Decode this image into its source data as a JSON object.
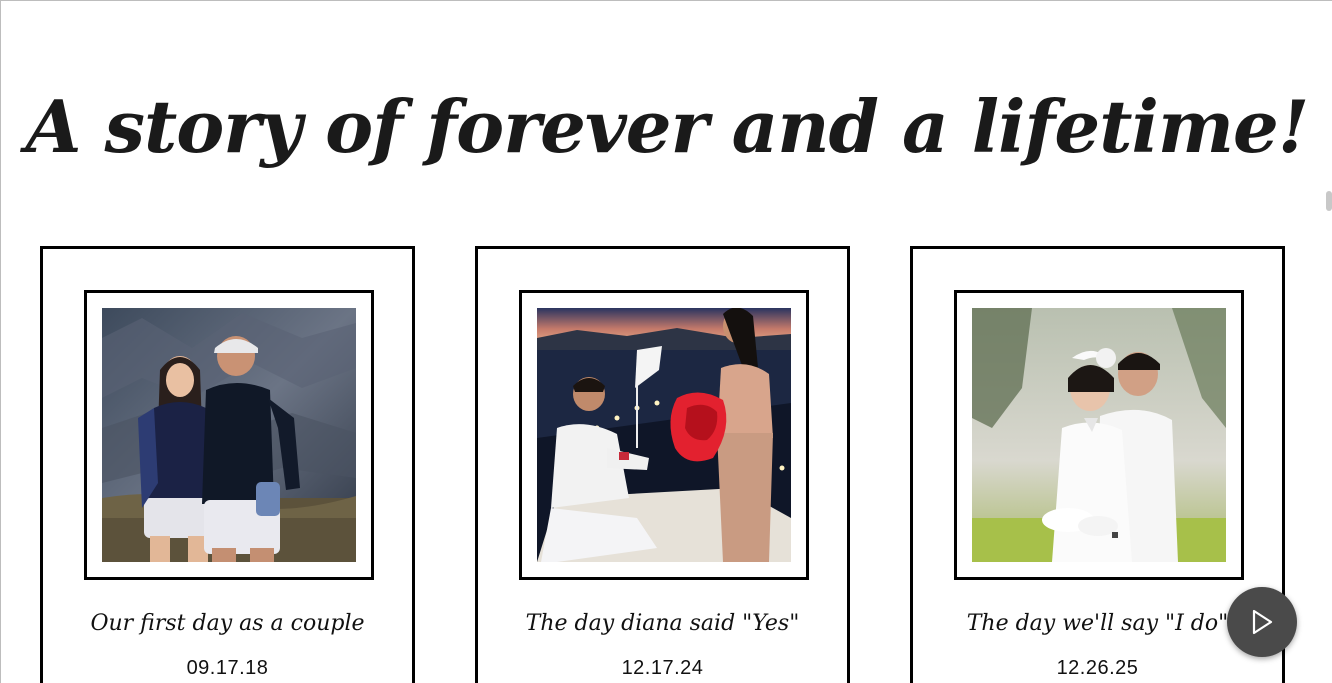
{
  "page": {
    "title": "A story of forever and a lifetime!"
  },
  "cards": [
    {
      "caption": "Our first day as a couple",
      "date": "09.17.18",
      "photo_icon": "couple-photo"
    },
    {
      "caption": "The day diana said \"Yes\"",
      "date": "12.17.24",
      "photo_icon": "proposal-photo"
    },
    {
      "caption": "The day we'll say \"I do\"",
      "date": "12.26.25",
      "photo_icon": "wedding-photo"
    }
  ],
  "controls": {
    "play_icon": "play-icon"
  },
  "colors": {
    "background": "#ffffff",
    "text": "#111111",
    "border": "#000000",
    "play_button": "#4a4a4a"
  }
}
